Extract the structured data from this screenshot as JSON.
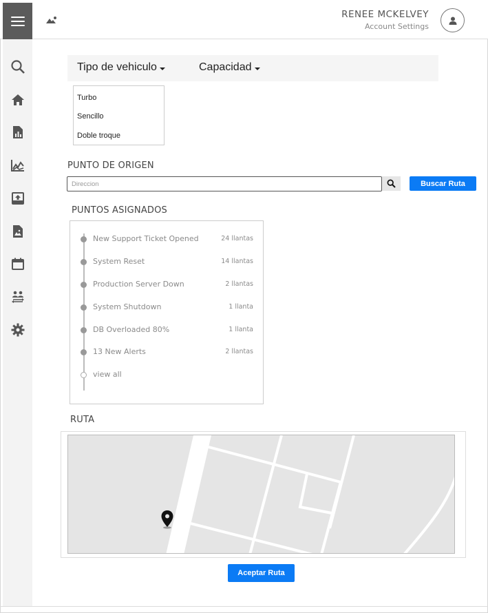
{
  "header": {
    "user_name": "RENEE MCKELVEY",
    "account_settings": "Account Settings"
  },
  "sidebar": {
    "items": [
      {
        "icon": "search-icon"
      },
      {
        "icon": "home-icon"
      },
      {
        "icon": "report-icon"
      },
      {
        "icon": "chart-icon"
      },
      {
        "icon": "upload-icon"
      },
      {
        "icon": "image-icon"
      },
      {
        "icon": "calendar-icon"
      },
      {
        "icon": "people-transfer-icon"
      },
      {
        "icon": "settings-icon"
      }
    ]
  },
  "filters": {
    "vehicle_type": "Tipo de vehiculo",
    "capacity": "Capacidad",
    "vehicle_options": [
      "Turbo",
      "Sencillo",
      "Doble troque"
    ]
  },
  "origin": {
    "title": "PUNTO DE ORIGEN",
    "placeholder": "Direccion",
    "search_button": "Buscar Ruta"
  },
  "assigned": {
    "title": "PUNTOS ASIGNADOS",
    "items": [
      {
        "label": "New Support Ticket Opened",
        "value": "24 llantas"
      },
      {
        "label": "System Reset",
        "value": "14 llantas"
      },
      {
        "label": "Production Server Down",
        "value": "2 llantas"
      },
      {
        "label": "System Shutdown",
        "value": "1 llanta"
      },
      {
        "label": "DB Overloaded 80%",
        "value": "1 llanta"
      },
      {
        "label": "13 New Alerts",
        "value": "2 llantas"
      }
    ],
    "view_all": "view all"
  },
  "route": {
    "title": "RUTA",
    "accept_button": "Aceptar Ruta"
  },
  "colors": {
    "accent": "#0b7bf5",
    "sidebar_bg": "#f3f3f3",
    "menu_bg": "#5b5b5b",
    "map_bg": "#e5e5e5"
  }
}
